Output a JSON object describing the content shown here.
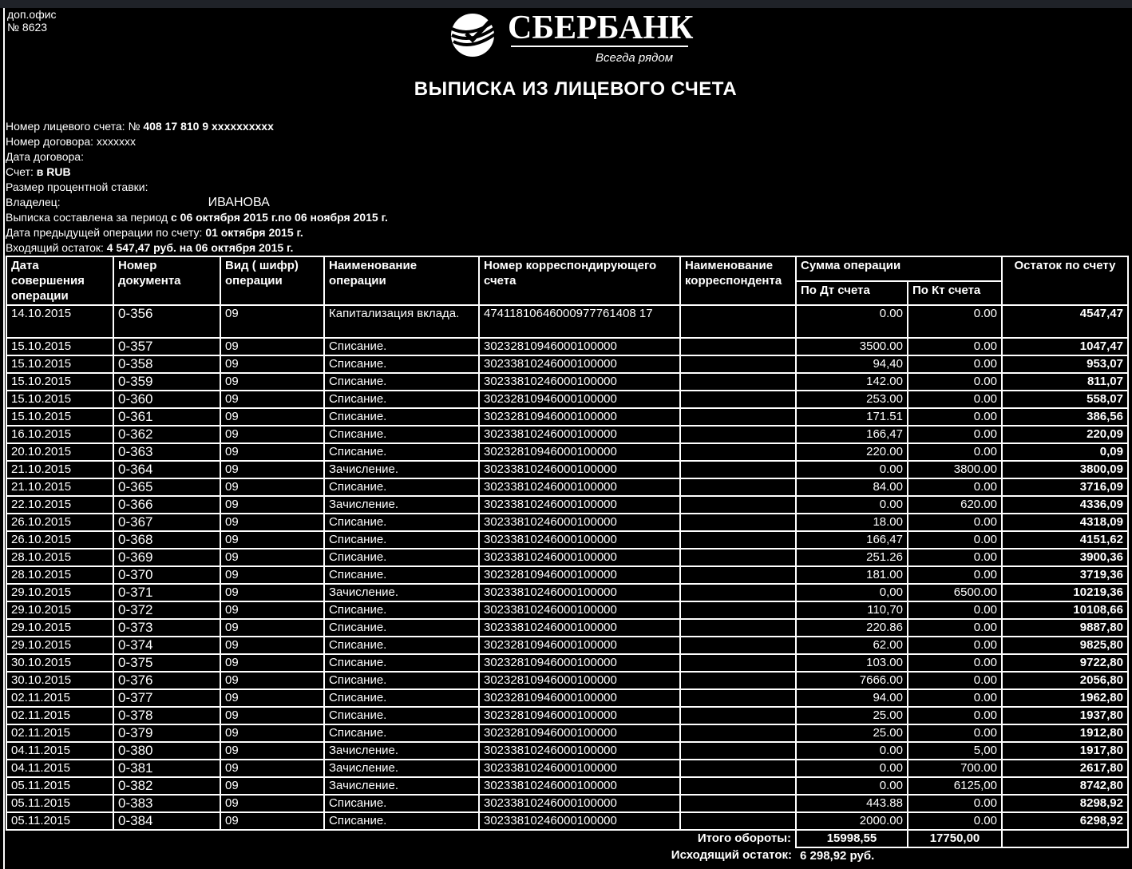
{
  "office": {
    "line1": "доп.офис",
    "line2": "№ 8623"
  },
  "brand": {
    "name": "СБЕРБАНК",
    "slogan": "Всегда рядом",
    "color": "#ffffff"
  },
  "title": "ВЫПИСКА ИЗ ЛИЦЕВОГО СЧЕТА",
  "meta": {
    "account_label": "Номер лицевого счета: №",
    "account_value": "408 17 810 9 xxxxxxxxxx",
    "contract_label": "Номер договора:",
    "contract_value": "xxxxxxx",
    "contract_date_label": "Дата договора:",
    "currency_label": "Счет:",
    "currency_value": "в RUB",
    "rate_label": "Размер процентной ставки:",
    "owner_label": "Владелец:",
    "owner_value": "ИВАНОВА",
    "period_label": "Выписка составлена за период",
    "period_value": "с 06 октября 2015 г.по 06 ноября 2015 г.",
    "prev_label": "Дата предыдущей операции по счету:",
    "prev_value": "01 октября 2015 г.",
    "opening_label": "Входящий остаток:",
    "opening_value": "4 547,47 руб. на 06 октября 2015 г."
  },
  "headers": {
    "date": "Дата совершения операции",
    "doc": "Номер документа",
    "code": "Вид ( шифр) операции",
    "name": "Наименование операции",
    "corr_account": "Номер корреспондирующего счета",
    "corr_name": "Наименование корреспондента",
    "amount": "Сумма операции",
    "debit": "По Дт счета",
    "credit": "По Кт счета",
    "balance": "Остаток по счету"
  },
  "rows": [
    {
      "date": "14.10.2015",
      "doc": "0-356",
      "code": "09",
      "name": "Капитализация вклада.",
      "acc": "47411810646000977761408 17",
      "debit": "0.00",
      "credit": "0.00",
      "balance": "4547,47"
    },
    {
      "date": "15.10.2015",
      "doc": "0-357",
      "code": "09",
      "name": "Списание.",
      "acc": "30232810946000100000",
      "debit": "3500.00",
      "credit": "0.00",
      "balance": "1047,47"
    },
    {
      "date": "15.10.2015",
      "doc": "0-358",
      "code": "09",
      "name": "Списание.",
      "acc": "30233810246000100000",
      "debit": "94,40",
      "credit": "0.00",
      "balance": "953,07"
    },
    {
      "date": "15.10.2015",
      "doc": "0-359",
      "code": "09",
      "name": "Списание.",
      "acc": "30233810246000100000",
      "debit": "142.00",
      "credit": "0.00",
      "balance": "811,07"
    },
    {
      "date": "15.10.2015",
      "doc": "0-360",
      "code": "09",
      "name": "Списание.",
      "acc": "30232810946000100000",
      "debit": "253.00",
      "credit": "0.00",
      "balance": "558,07"
    },
    {
      "date": "15.10.2015",
      "doc": "0-361",
      "code": "09",
      "name": "Списание.",
      "acc": "30232810946000100000",
      "debit": "171.51",
      "credit": "0.00",
      "balance": "386,56"
    },
    {
      "date": "16.10.2015",
      "doc": "0-362",
      "code": "09",
      "name": "Списание.",
      "acc": "30233810246000100000",
      "debit": "166,47",
      "credit": "0.00",
      "balance": "220,09"
    },
    {
      "date": "20.10.2015",
      "doc": "0-363",
      "code": "09",
      "name": "Списание.",
      "acc": "30232810946000100000",
      "debit": "220.00",
      "credit": "0.00",
      "balance": "0,09"
    },
    {
      "date": "21.10.2015",
      "doc": "0-364",
      "code": "09",
      "name": "Зачисление.",
      "acc": "30233810246000100000",
      "debit": "0.00",
      "credit": "3800.00",
      "balance": "3800,09"
    },
    {
      "date": "21.10.2015",
      "doc": "0-365",
      "code": "09",
      "name": "Списание.",
      "acc": "30233810246000100000",
      "debit": "84.00",
      "credit": "0.00",
      "balance": "3716,09"
    },
    {
      "date": "22.10.2015",
      "doc": "0-366",
      "code": "09",
      "name": "Зачисление.",
      "acc": "30233810246000100000",
      "debit": "0.00",
      "credit": "620.00",
      "balance": "4336,09"
    },
    {
      "date": "26.10.2015",
      "doc": "0-367",
      "code": "09",
      "name": "Списание.",
      "acc": "30233810246000100000",
      "debit": "18.00",
      "credit": "0.00",
      "balance": "4318,09"
    },
    {
      "date": "26.10.2015",
      "doc": "0-368",
      "code": "09",
      "name": "Списание.",
      "acc": "30233810246000100000",
      "debit": "166,47",
      "credit": "0.00",
      "balance": "4151,62"
    },
    {
      "date": "28.10.2015",
      "doc": "0-369",
      "code": "09",
      "name": "Списание.",
      "acc": "30233810246000100000",
      "debit": "251.26",
      "credit": "0.00",
      "balance": "3900,36"
    },
    {
      "date": "28.10.2015",
      "doc": "0-370",
      "code": "09",
      "name": "Списание.",
      "acc": "30232810946000100000",
      "debit": "181.00",
      "credit": "0.00",
      "balance": "3719,36"
    },
    {
      "date": "29.10.2015",
      "doc": "0-371",
      "code": "09",
      "name": "Зачисление.",
      "acc": "30233810246000100000",
      "debit": "0,00",
      "credit": "6500.00",
      "balance": "10219,36"
    },
    {
      "date": "29.10.2015",
      "doc": "0-372",
      "code": "09",
      "name": "Списание.",
      "acc": "30233810246000100000",
      "debit": "110,70",
      "credit": "0.00",
      "balance": "10108,66"
    },
    {
      "date": "29.10.2015",
      "doc": "0-373",
      "code": "09",
      "name": "Списание.",
      "acc": "30233810246000100000",
      "debit": "220.86",
      "credit": "0.00",
      "balance": "9887,80"
    },
    {
      "date": "29.10.2015",
      "doc": "0-374",
      "code": "09",
      "name": "Списание.",
      "acc": "30232810946000100000",
      "debit": "62.00",
      "credit": "0.00",
      "balance": "9825,80"
    },
    {
      "date": "30.10.2015",
      "doc": "0-375",
      "code": "09",
      "name": "Списание.",
      "acc": "30232810946000100000",
      "debit": "103.00",
      "credit": "0.00",
      "balance": "9722,80"
    },
    {
      "date": "30.10.2015",
      "doc": "0-376",
      "code": "09",
      "name": "Списание.",
      "acc": "30232810946000100000",
      "debit": "7666.00",
      "credit": "0.00",
      "balance": "2056,80"
    },
    {
      "date": "02.11.2015",
      "doc": "0-377",
      "code": "09",
      "name": "Списание.",
      "acc": "30232810946000100000",
      "debit": "94.00",
      "credit": "0.00",
      "balance": "1962,80"
    },
    {
      "date": "02.11.2015",
      "doc": "0-378",
      "code": "09",
      "name": "Списание.",
      "acc": "30232810946000100000",
      "debit": "25.00",
      "credit": "0.00",
      "balance": "1937,80"
    },
    {
      "date": "02.11.2015",
      "doc": "0-379",
      "code": "09",
      "name": "Списание.",
      "acc": "30232810946000100000",
      "debit": "25.00",
      "credit": "0.00",
      "balance": "1912,80"
    },
    {
      "date": "04.11.2015",
      "doc": "0-380",
      "code": "09",
      "name": "Зачисление.",
      "acc": "30233810246000100000",
      "debit": "0.00",
      "credit": "5,00",
      "balance": "1917,80"
    },
    {
      "date": "04.11.2015",
      "doc": "0-381",
      "code": "09",
      "name": "Зачисление.",
      "acc": "30233810246000100000",
      "debit": "0.00",
      "credit": "700.00",
      "balance": "2617,80"
    },
    {
      "date": "05.11.2015",
      "doc": "0-382",
      "code": "09",
      "name": "Зачисление.",
      "acc": "30233810246000100000",
      "debit": "0.00",
      "credit": "6125,00",
      "balance": "8742,80"
    },
    {
      "date": "05.11.2015",
      "doc": "0-383",
      "code": "09",
      "name": "Списание.",
      "acc": "30233810246000100000",
      "debit": "443.88",
      "credit": "0.00",
      "balance": "8298,92"
    },
    {
      "date": "05.11.2015",
      "doc": "0-384",
      "code": "09",
      "name": "Списание.",
      "acc": "30233810246000100000",
      "debit": "2000.00",
      "credit": "0.00",
      "balance": "6298,92"
    }
  ],
  "totals": {
    "label": "Итого обороты:",
    "debit": "15998,55",
    "credit": "17750,00"
  },
  "outgoing": {
    "label": "Исходящий остаток:",
    "value": "6 298,92 руб."
  }
}
